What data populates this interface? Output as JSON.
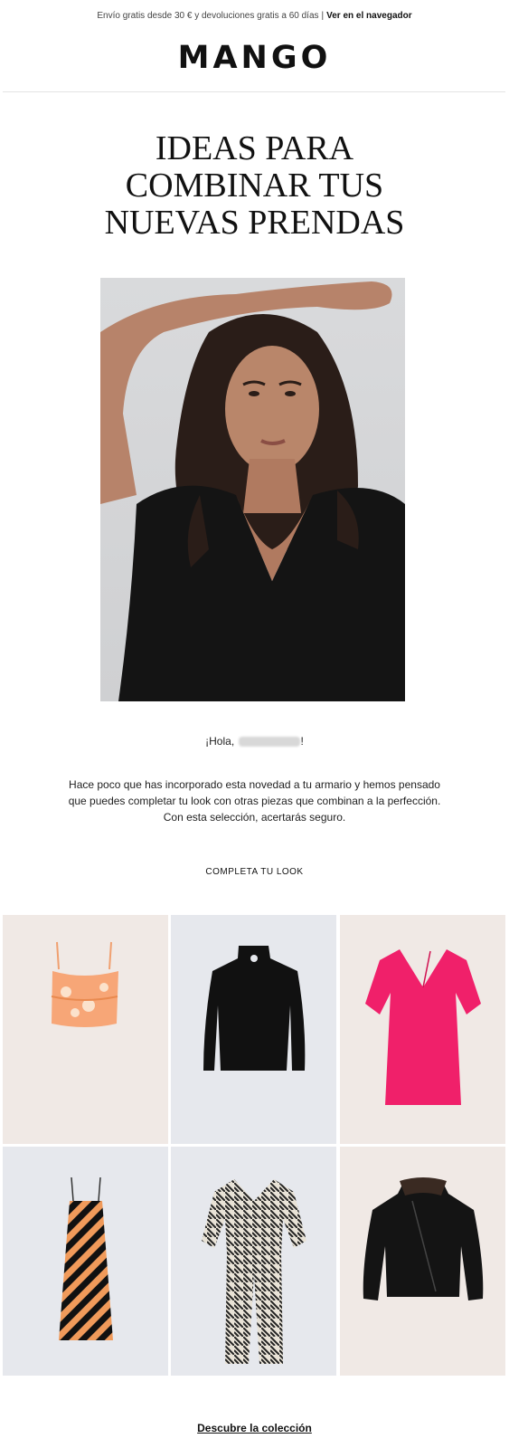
{
  "topbar": {
    "promo_text": "Envío gratis desde 30 € y devoluciones gratis a 60 días",
    "separator": "|",
    "browser_link": "Ver en el navegador"
  },
  "brand": {
    "logo_text": "MANGO"
  },
  "headline": {
    "line1": "IDEAS PARA",
    "line2": "COMBINAR TUS",
    "line3": "NUEVAS PRENDAS"
  },
  "greeting": {
    "prefix": "¡Hola,",
    "suffix": "!"
  },
  "body": {
    "line1": "Hace poco que has incorporado esta novedad a tu armario y hemos pensado",
    "line2": "que puedes completar tu look con otras piezas que combinan a la perfección.",
    "line3": "Con esta selección, acertarás seguro."
  },
  "section": {
    "title": "COMPLETA TU LOOK"
  },
  "products": [
    {
      "icon": "orange-floral-crop-top-icon",
      "bg": "#f0e9e5"
    },
    {
      "icon": "black-blouse-icon",
      "bg": "#e6e8ed"
    },
    {
      "icon": "pink-dress-icon",
      "bg": "#f0e9e5"
    },
    {
      "icon": "striped-slip-dress-icon",
      "bg": "#e6e8ed"
    },
    {
      "icon": "printed-jumpsuit-icon",
      "bg": "#e6e8ed"
    },
    {
      "icon": "leather-jacket-icon",
      "bg": "#f0e9e5"
    }
  ],
  "cta": {
    "label": "Descubre la colección"
  },
  "colors": {
    "text": "#1a1a1a",
    "warm_bg": "#f0e9e5",
    "cool_bg": "#e6e8ed",
    "pink": "#f0206a",
    "orange": "#f4a060"
  }
}
